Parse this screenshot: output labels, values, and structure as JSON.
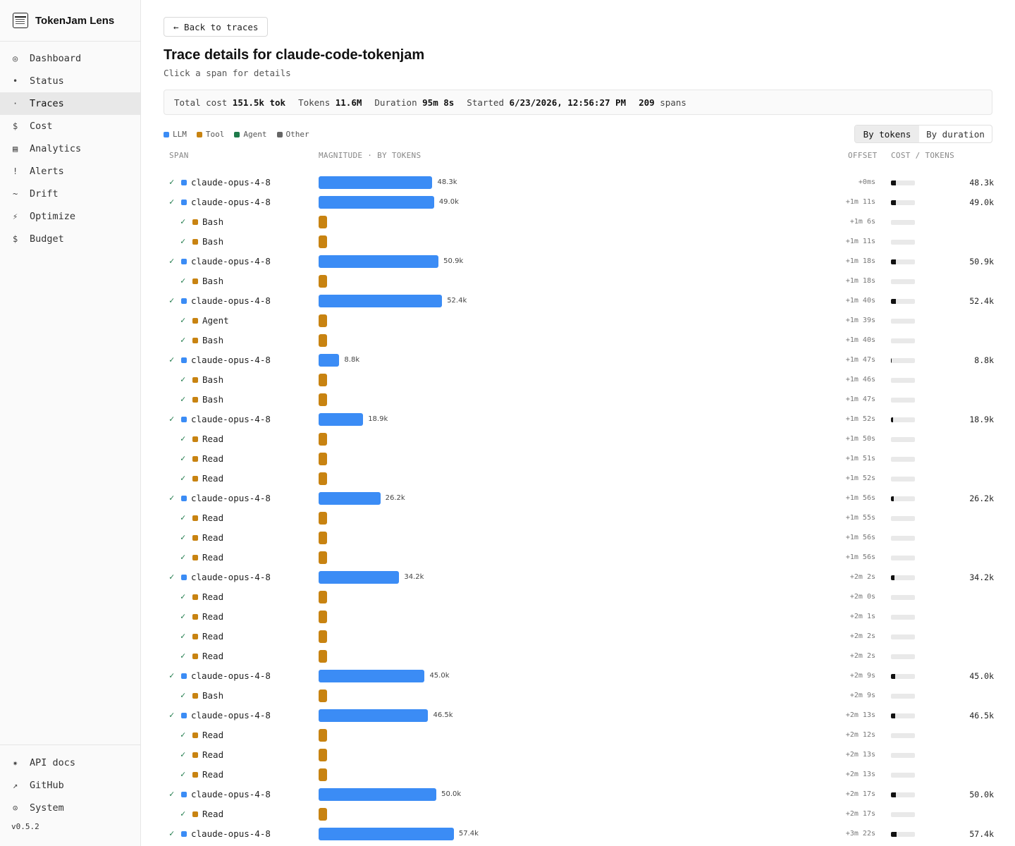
{
  "app": {
    "name": "TokenJam Lens",
    "version": "v0.5.2"
  },
  "nav": [
    {
      "icon": "◎",
      "label": "Dashboard",
      "active": false
    },
    {
      "icon": "•",
      "label": "Status",
      "active": false
    },
    {
      "icon": "·",
      "label": "Traces",
      "active": true
    },
    {
      "icon": "$",
      "label": "Cost",
      "active": false
    },
    {
      "icon": "▤",
      "label": "Analytics",
      "active": false
    },
    {
      "icon": "!",
      "label": "Alerts",
      "active": false
    },
    {
      "icon": "~",
      "label": "Drift",
      "active": false
    },
    {
      "icon": "⚡",
      "label": "Optimize",
      "active": false
    },
    {
      "icon": "$",
      "label": "Budget",
      "active": false
    }
  ],
  "nav_bottom": [
    {
      "icon": "✷",
      "label": "API docs"
    },
    {
      "icon": "↗",
      "label": "GitHub"
    },
    {
      "icon": "⊙",
      "label": "System"
    }
  ],
  "page": {
    "back_label": "← Back to traces",
    "title": "Trace details for claude-code-tokenjam",
    "subtitle": "Click a span for details"
  },
  "summary": {
    "cost_label": "Total cost",
    "cost_value": "151.5k tok",
    "tokens_label": "Tokens",
    "tokens_value": "11.6M",
    "duration_label": "Duration",
    "duration_value": "95m 8s",
    "started_label": "Started",
    "started_value": "6/23/2026, 12:56:27 PM",
    "spans_value": "209",
    "spans_label": "spans"
  },
  "legend": [
    {
      "label": "LLM",
      "color": "#3b8cf5"
    },
    {
      "label": "Tool",
      "color": "#c88311"
    },
    {
      "label": "Agent",
      "color": "#1e7a4a"
    },
    {
      "label": "Other",
      "color": "#666666"
    }
  ],
  "toggle": {
    "tokens": "By tokens",
    "duration": "By duration",
    "selected": "tokens"
  },
  "columns": {
    "span": "SPAN",
    "magnitude": "MAGNITUDE · BY TOKENS",
    "offset": "OFFSET",
    "cost": "COST / TOKENS"
  },
  "colors": {
    "llm": "#3b8cf5",
    "tool": "#c88311",
    "ok": "#1e7a4a"
  },
  "max_tokens_k": 100,
  "spans": [
    {
      "name": "claude-opus-4-8",
      "type": "llm",
      "depth": 0,
      "tokens_k": 48.3,
      "tokens": "48.3k",
      "offset": "+0ms"
    },
    {
      "name": "claude-opus-4-8",
      "type": "llm",
      "depth": 0,
      "tokens_k": 49.0,
      "tokens": "49.0k",
      "offset": "+1m 11s"
    },
    {
      "name": "Bash",
      "type": "tool",
      "depth": 1,
      "offset": "+1m 6s"
    },
    {
      "name": "Bash",
      "type": "tool",
      "depth": 1,
      "offset": "+1m 11s"
    },
    {
      "name": "claude-opus-4-8",
      "type": "llm",
      "depth": 0,
      "tokens_k": 50.9,
      "tokens": "50.9k",
      "offset": "+1m 18s"
    },
    {
      "name": "Bash",
      "type": "tool",
      "depth": 1,
      "offset": "+1m 18s"
    },
    {
      "name": "claude-opus-4-8",
      "type": "llm",
      "depth": 0,
      "tokens_k": 52.4,
      "tokens": "52.4k",
      "offset": "+1m 40s"
    },
    {
      "name": "Agent",
      "type": "tool",
      "depth": 1,
      "offset": "+1m 39s"
    },
    {
      "name": "Bash",
      "type": "tool",
      "depth": 1,
      "offset": "+1m 40s"
    },
    {
      "name": "claude-opus-4-8",
      "type": "llm",
      "depth": 0,
      "tokens_k": 8.8,
      "tokens": "8.8k",
      "offset": "+1m 47s"
    },
    {
      "name": "Bash",
      "type": "tool",
      "depth": 1,
      "offset": "+1m 46s"
    },
    {
      "name": "Bash",
      "type": "tool",
      "depth": 1,
      "offset": "+1m 47s"
    },
    {
      "name": "claude-opus-4-8",
      "type": "llm",
      "depth": 0,
      "tokens_k": 18.9,
      "tokens": "18.9k",
      "offset": "+1m 52s"
    },
    {
      "name": "Read",
      "type": "tool",
      "depth": 1,
      "offset": "+1m 50s"
    },
    {
      "name": "Read",
      "type": "tool",
      "depth": 1,
      "offset": "+1m 51s"
    },
    {
      "name": "Read",
      "type": "tool",
      "depth": 1,
      "offset": "+1m 52s"
    },
    {
      "name": "claude-opus-4-8",
      "type": "llm",
      "depth": 0,
      "tokens_k": 26.2,
      "tokens": "26.2k",
      "offset": "+1m 56s"
    },
    {
      "name": "Read",
      "type": "tool",
      "depth": 1,
      "offset": "+1m 55s"
    },
    {
      "name": "Read",
      "type": "tool",
      "depth": 1,
      "offset": "+1m 56s"
    },
    {
      "name": "Read",
      "type": "tool",
      "depth": 1,
      "offset": "+1m 56s"
    },
    {
      "name": "claude-opus-4-8",
      "type": "llm",
      "depth": 0,
      "tokens_k": 34.2,
      "tokens": "34.2k",
      "offset": "+2m 2s"
    },
    {
      "name": "Read",
      "type": "tool",
      "depth": 1,
      "offset": "+2m 0s"
    },
    {
      "name": "Read",
      "type": "tool",
      "depth": 1,
      "offset": "+2m 1s"
    },
    {
      "name": "Read",
      "type": "tool",
      "depth": 1,
      "offset": "+2m 2s"
    },
    {
      "name": "Read",
      "type": "tool",
      "depth": 1,
      "offset": "+2m 2s"
    },
    {
      "name": "claude-opus-4-8",
      "type": "llm",
      "depth": 0,
      "tokens_k": 45.0,
      "tokens": "45.0k",
      "offset": "+2m 9s"
    },
    {
      "name": "Bash",
      "type": "tool",
      "depth": 1,
      "offset": "+2m 9s"
    },
    {
      "name": "claude-opus-4-8",
      "type": "llm",
      "depth": 0,
      "tokens_k": 46.5,
      "tokens": "46.5k",
      "offset": "+2m 13s"
    },
    {
      "name": "Read",
      "type": "tool",
      "depth": 1,
      "offset": "+2m 12s"
    },
    {
      "name": "Read",
      "type": "tool",
      "depth": 1,
      "offset": "+2m 13s"
    },
    {
      "name": "Read",
      "type": "tool",
      "depth": 1,
      "offset": "+2m 13s"
    },
    {
      "name": "claude-opus-4-8",
      "type": "llm",
      "depth": 0,
      "tokens_k": 50.0,
      "tokens": "50.0k",
      "offset": "+2m 17s"
    },
    {
      "name": "Read",
      "type": "tool",
      "depth": 1,
      "offset": "+2m 17s"
    },
    {
      "name": "claude-opus-4-8",
      "type": "llm",
      "depth": 0,
      "tokens_k": 57.4,
      "tokens": "57.4k",
      "offset": "+3m 22s"
    }
  ]
}
